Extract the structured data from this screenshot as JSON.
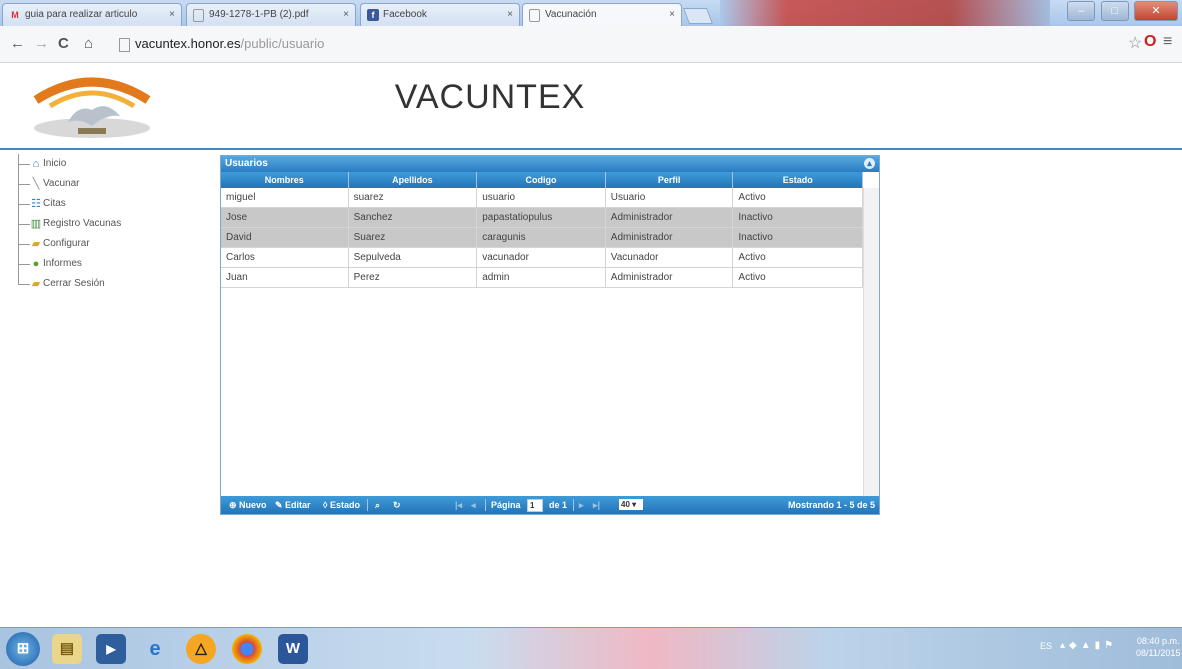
{
  "browser": {
    "tabs": [
      {
        "title": "guia para realizar articulo",
        "icon": "gmail-icon"
      },
      {
        "title": "949-1278-1-PB (2).pdf",
        "icon": "document-icon"
      },
      {
        "title": "Facebook",
        "icon": "facebook-icon"
      },
      {
        "title": "Vacunación",
        "icon": "document-icon",
        "active": true
      }
    ],
    "url_host": "vacuntex.honor.es",
    "url_path": "/public/usuario"
  },
  "app": {
    "title": "VACUNTEX",
    "logo_text": "TODOS LOS DÍAS SON DÍAS DE VACUNACIÓN"
  },
  "sidebar": {
    "items": [
      {
        "label": "Inicio",
        "icon": "home-icon"
      },
      {
        "label": "Vacunar",
        "icon": "syringe-icon"
      },
      {
        "label": "Citas",
        "icon": "calendar-icon"
      },
      {
        "label": "Registro Vacunas",
        "icon": "chart-icon"
      },
      {
        "label": "Configurar",
        "icon": "folder-icon"
      },
      {
        "label": "Informes",
        "icon": "report-icon"
      },
      {
        "label": "Cerrar Sesión",
        "icon": "folder-icon"
      }
    ]
  },
  "grid": {
    "caption": "Usuarios",
    "columns": [
      "Nombres",
      "Apellidos",
      "Codigo",
      "Perfil",
      "Estado"
    ],
    "rows": [
      {
        "cells": [
          "miguel",
          "suarez",
          "usuario",
          "Usuario",
          "Activo"
        ],
        "selected": false
      },
      {
        "cells": [
          "Jose",
          "Sanchez",
          "papastatiopulus",
          "Administrador",
          "Inactivo"
        ],
        "selected": true
      },
      {
        "cells": [
          "David",
          "Suarez",
          "caragunis",
          "Administrador",
          "Inactivo"
        ],
        "selected": true
      },
      {
        "cells": [
          "Carlos",
          "Sepulveda",
          "vacunador",
          "Vacunador",
          "Activo"
        ],
        "selected": false
      },
      {
        "cells": [
          "Juan",
          "Perez",
          "admin",
          "Administrador",
          "Activo"
        ],
        "selected": false
      }
    ],
    "pager": {
      "new_label": "Nuevo",
      "edit_label": "Editar",
      "status_label": "Estado",
      "page_label": "Página",
      "page_value": "1",
      "of_label": "de 1",
      "rows_per_page": "40",
      "summary": "Mostrando 1 - 5 de 5"
    }
  },
  "taskbar": {
    "apps": [
      "start-button",
      "explorer-icon",
      "media-player-icon",
      "ie-icon",
      "avast-icon",
      "chrome-icon",
      "word-icon"
    ],
    "language": "ES",
    "time": "08:40 p.m.",
    "date": "08/11/2015"
  },
  "colors": {
    "accent": "#2b7cc2",
    "header_line": "#3a8ec9",
    "selected_row": "#c8c8c8"
  }
}
